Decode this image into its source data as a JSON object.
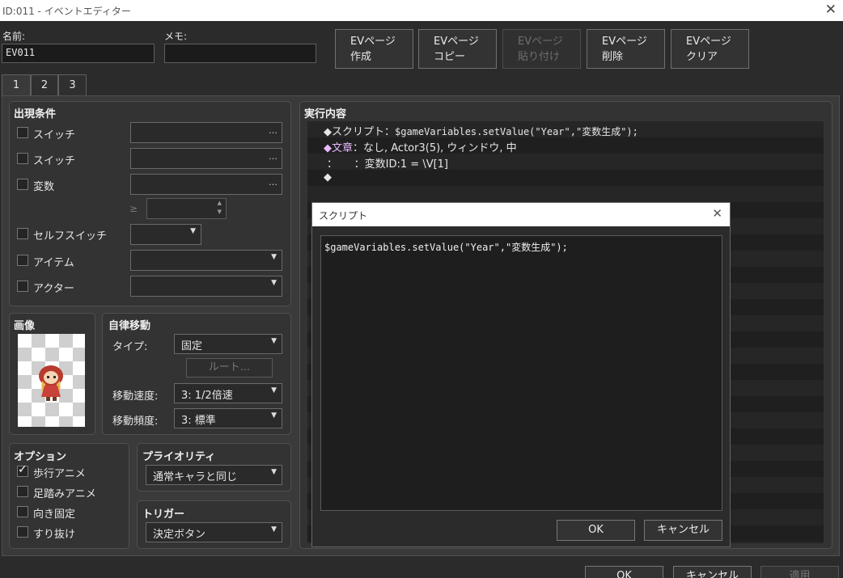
{
  "window": {
    "title": "ID:011 - イベントエディター"
  },
  "name": {
    "label": "名前:",
    "value": "EV011"
  },
  "memo": {
    "label": "メモ:",
    "value": ""
  },
  "toolbar": [
    {
      "line1": "EVページ",
      "line2": "作成",
      "enabled": true
    },
    {
      "line1": "EVページ",
      "line2": "コピー",
      "enabled": true
    },
    {
      "line1": "EVページ",
      "line2": "貼り付け",
      "enabled": false
    },
    {
      "line1": "EVページ",
      "line2": "削除",
      "enabled": true
    },
    {
      "line1": "EVページ",
      "line2": "クリア",
      "enabled": true
    }
  ],
  "tabs": [
    "1",
    "2",
    "3"
  ],
  "conditions": {
    "title": "出現条件",
    "switch1": "スイッチ",
    "switch2": "スイッチ",
    "variable": "変数",
    "ge": "≥",
    "self_switch": "セルフスイッチ",
    "item": "アイテム",
    "actor": "アクター",
    "dots": "…"
  },
  "image": {
    "title": "画像"
  },
  "movement": {
    "title": "自律移動",
    "type_label": "タイプ:",
    "type_value": "固定",
    "route_button": "ルート...",
    "speed_label": "移動速度:",
    "speed_value": "3: 1/2倍速",
    "freq_label": "移動頻度:",
    "freq_value": "3: 標準"
  },
  "options": {
    "title": "オプション",
    "walk_anim": {
      "label": "歩行アニメ",
      "checked": true
    },
    "step_anim": {
      "label": "足踏みアニメ",
      "checked": false
    },
    "dir_fix": {
      "label": "向き固定",
      "checked": false
    },
    "through": {
      "label": "すり抜け",
      "checked": false
    }
  },
  "priority": {
    "title": "プライオリティ",
    "value": "通常キャラと同じ"
  },
  "trigger": {
    "title": "トリガー",
    "value": "決定ボタン"
  },
  "contents": {
    "title": "実行内容",
    "line1_prefix": "◆スクリプト：",
    "line1_code": "$gameVariables.setValue(\"Year\",\"変数生成\");",
    "line2_prefix": "◆文章",
    "line2_rest": "：なし, Actor3(5), ウィンドウ, 中",
    "line3": "：     ：変数ID:1 = \\V[1]",
    "line4": "◆"
  },
  "script_dialog": {
    "title": "スクリプト",
    "code": "$gameVariables.setValue(\"Year\",\"変数生成\");",
    "ok": "OK",
    "cancel": "キャンセル"
  },
  "footer": {
    "ok": "OK",
    "cancel": "キャンセル",
    "apply": "適用"
  }
}
